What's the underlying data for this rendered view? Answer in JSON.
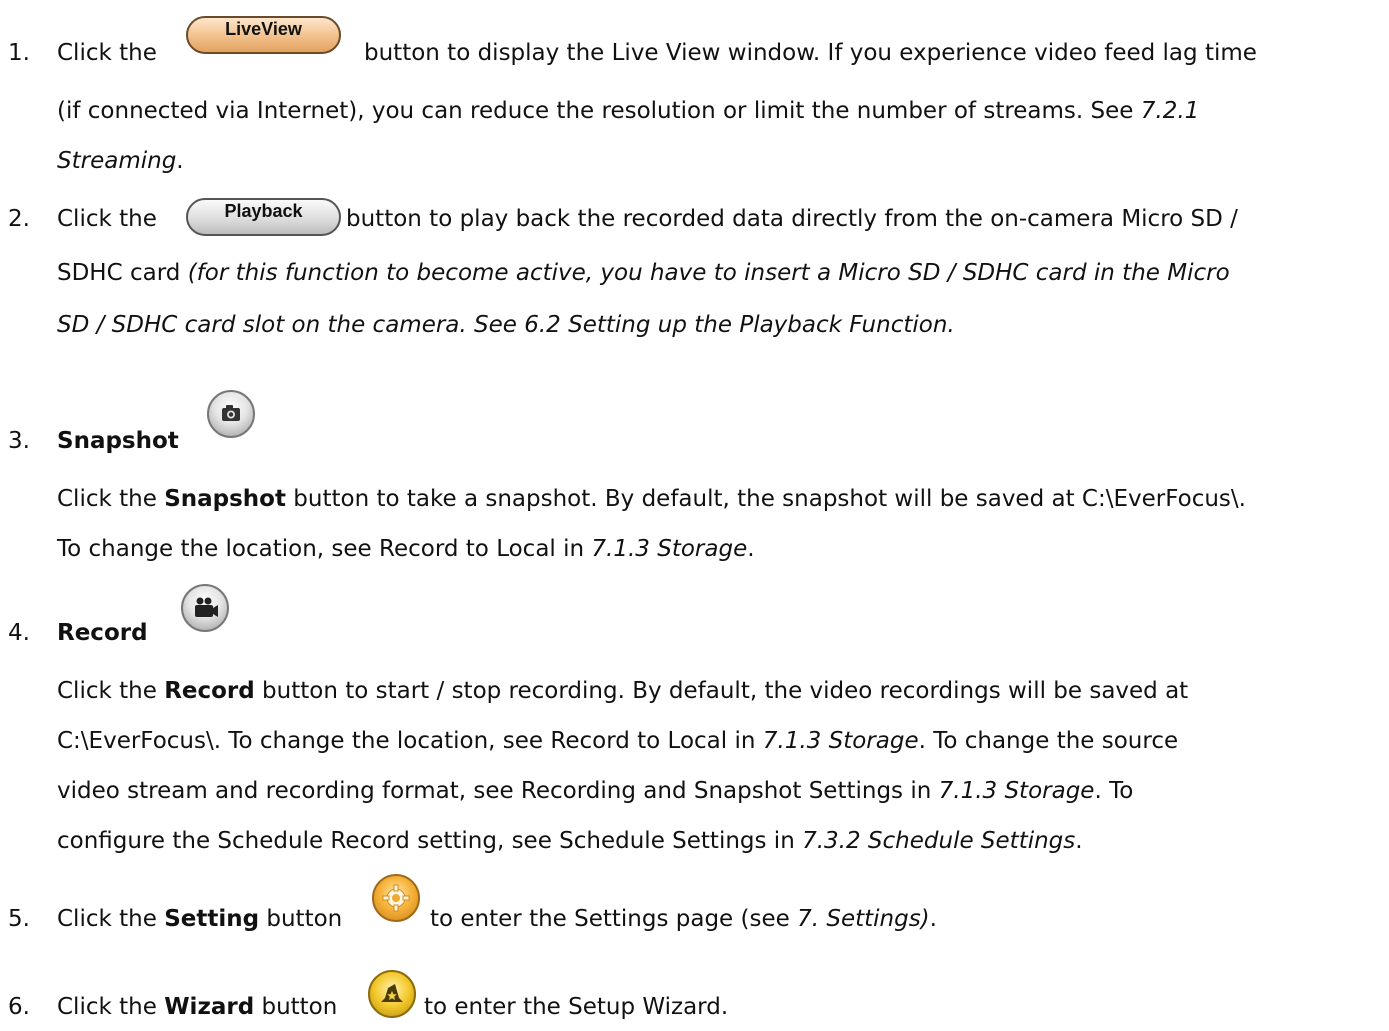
{
  "items": [
    {
      "number": "1.",
      "button_label": "LiveView",
      "line1_pre": "Click the",
      "line1_post": "button to display the Live View window. If you experience video feed lag time",
      "line2": "(if connected via Internet), you can reduce the resolution or limit the number of streams. See ",
      "line2_ref": "7.2.1",
      "line3_ref": "Streaming",
      "line3_post": "."
    },
    {
      "number": "2.",
      "button_label": "Playback",
      "line1_pre": "Click the",
      "line1_post": "button to play back the recorded data directly from the on-camera Micro SD /",
      "line2_pre": "SDHC card ",
      "line2_italic": "(for this function to become active, you have to insert a Micro SD / SDHC card in the Micro",
      "line3_italic": "SD / SDHC card slot on the camera. See 6.2 Setting up the Playback Function."
    },
    {
      "number": "3.",
      "title": "Snapshot",
      "icon": "camera-icon",
      "p1_a": "Click the ",
      "p1_b": "Snapshot",
      "p1_c": " button to take a snapshot. By default, the snapshot will be saved at C:\\EverFocus\\.",
      "p2_a": "To change the location, see Record to Local in ",
      "p2_ref": "7.1.3 Storage",
      "p2_c": "."
    },
    {
      "number": "4.",
      "title": "Record",
      "icon": "video-camera-icon",
      "l1_a": "Click the ",
      "l1_b": "Record",
      "l1_c": " button to start / stop recording. By default, the video recordings will be saved at",
      "l2_a": "C:\\EverFocus\\. To change the location, see Record to Local in ",
      "l2_ref": "7.1.3 Storage",
      "l2_c": ". To change the source",
      "l3_a": "video stream and recording format, see Recording and Snapshot Settings in ",
      "l3_ref": "7.1.3 Storage",
      "l3_c": ". To",
      "l4_a": "configure the Schedule Record setting, see Schedule Settings in ",
      "l4_ref": "7.3.2 Schedule Settings",
      "l4_c": "."
    },
    {
      "number": "5.",
      "a": "Click the ",
      "b": "Setting",
      "c": " button",
      "icon": "gear-icon",
      "d": "to enter the Settings page (see ",
      "ref": "7. Settings)",
      "e": "."
    },
    {
      "number": "6.",
      "a": "Click the ",
      "b": "Wizard",
      "c": " button",
      "icon": "wizard-hat-icon",
      "d": "to enter the Setup Wizard."
    }
  ],
  "colors": {
    "text": "#111111",
    "liveview_button": "#f2c08a",
    "playback_button": "#dedede",
    "setting_icon": "#f7b43a",
    "wizard_icon": "#f2c82a"
  }
}
